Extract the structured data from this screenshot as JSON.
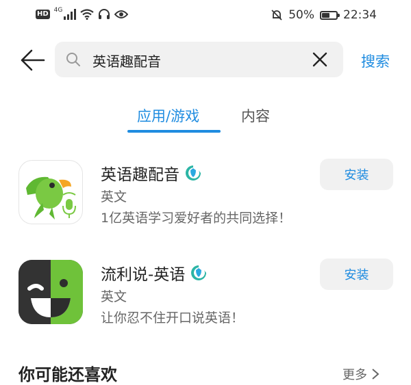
{
  "status_bar": {
    "hd": "HD",
    "network": "4G",
    "battery": "50%",
    "battery_level": 0.5,
    "time": "22:34"
  },
  "search": {
    "query": "英语趣配音",
    "submit_label": "搜索"
  },
  "tabs": [
    {
      "label": "应用/游戏",
      "active": true
    },
    {
      "label": "内容",
      "active": false
    }
  ],
  "results": [
    {
      "name": "英语趣配音",
      "category": "英文",
      "description": "1亿英语学习爱好者的共同选择！",
      "install_label": "安装"
    },
    {
      "name": "流利说-英语",
      "category": "英文",
      "description": "让你忍不住开口说英语！",
      "install_label": "安装"
    }
  ],
  "recommend": {
    "title": "你可能还喜欢",
    "more_label": "更多"
  },
  "colors": {
    "accent": "#1f8ce0",
    "parrot_green": "#7ac943",
    "liulishuo_green": "#6fc23a"
  }
}
